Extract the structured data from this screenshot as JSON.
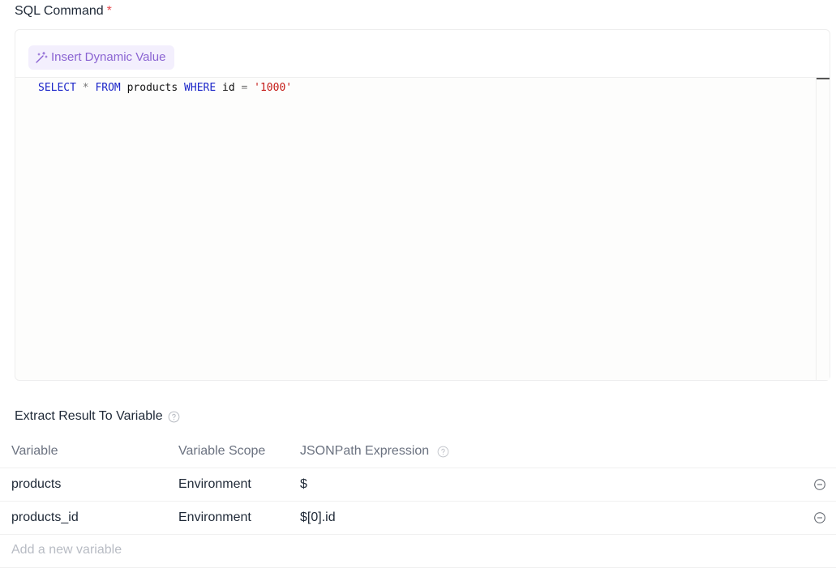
{
  "sql_field": {
    "label": "SQL Command",
    "required_mark": "*",
    "insert_button_label": "Insert Dynamic Value",
    "code_tokens": [
      {
        "text": "SELECT",
        "kind": "kw"
      },
      {
        "text": " ",
        "kind": "id"
      },
      {
        "text": "*",
        "kind": "op"
      },
      {
        "text": " ",
        "kind": "id"
      },
      {
        "text": "FROM",
        "kind": "kw"
      },
      {
        "text": " products ",
        "kind": "id"
      },
      {
        "text": "WHERE",
        "kind": "kw"
      },
      {
        "text": " id ",
        "kind": "id"
      },
      {
        "text": "=",
        "kind": "op"
      },
      {
        "text": " ",
        "kind": "id"
      },
      {
        "text": "'1000'",
        "kind": "str"
      }
    ]
  },
  "extract": {
    "title": "Extract Result To Variable",
    "columns": {
      "variable": "Variable",
      "scope": "Variable Scope",
      "jsonpath": "JSONPath Expression"
    },
    "rows": [
      {
        "variable": "products",
        "scope": "Environment",
        "jsonpath": "$"
      },
      {
        "variable": "products_id",
        "scope": "Environment",
        "jsonpath": "$[0].id"
      }
    ],
    "add_placeholder": "Add a new variable"
  },
  "colors": {
    "accent": "#8a63d2",
    "keyword": "#1d27c9",
    "string": "#c41a16",
    "required": "#e5484d"
  },
  "icons": {
    "insert": "magic-wand-icon",
    "help": "question-circle-icon",
    "remove": "minus-circle-icon"
  }
}
